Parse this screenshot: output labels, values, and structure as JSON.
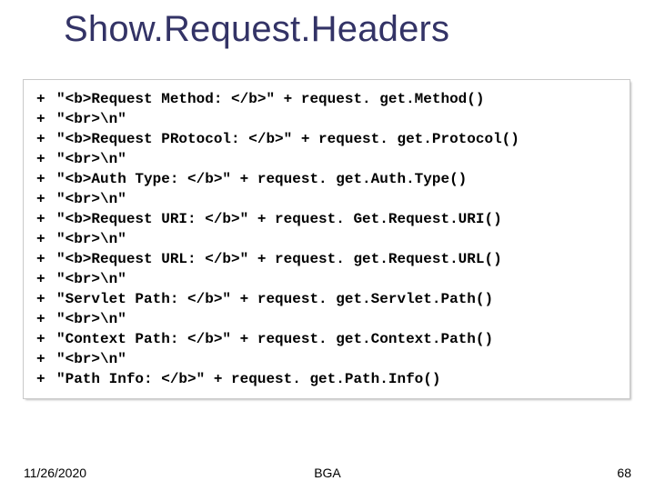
{
  "title": "Show.Request.Headers",
  "code_lines": [
    "\"<b>Request Method: </b>\" + request. get.Method()",
    "\"<br>\\n\"",
    "\"<b>Request PRotocol: </b>\" + request. get.Protocol()",
    "\"<br>\\n\"",
    "\"<b>Auth Type: </b>\" + request. get.Auth.Type()",
    "\"<br>\\n\"",
    "\"<b>Request URI: </b>\" + request. Get.Request.URI()",
    "\"<br>\\n\"",
    "\"<b>Request URL: </b>\" + request. get.Request.URL()",
    "\"<br>\\n\"",
    "\"Servlet Path: </b>\" + request. get.Servlet.Path()",
    "\"<br>\\n\"",
    "\"Context Path: </b>\" + request. get.Context.Path()",
    "\"<br>\\n\"",
    "\"Path Info: </b>\" + request. get.Path.Info()"
  ],
  "bullet": "+",
  "footer": {
    "date": "11/26/2020",
    "center": "BGA",
    "page": "68"
  }
}
